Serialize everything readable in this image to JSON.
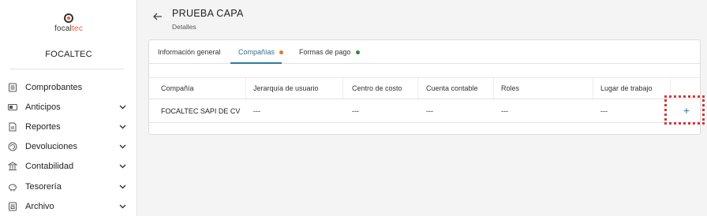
{
  "sidebar": {
    "logo": {
      "part1": "focal",
      "part2": "tec"
    },
    "company": "FOCALTEC",
    "items": [
      {
        "label": "Comprobantes",
        "icon": "document-list-icon",
        "expandable": false
      },
      {
        "label": "Anticipos",
        "icon": "cash-icon",
        "expandable": true
      },
      {
        "label": "Reportes",
        "icon": "report-icon",
        "expandable": true
      },
      {
        "label": "Devoluciones",
        "icon": "refund-icon",
        "expandable": true
      },
      {
        "label": "Contabilidad",
        "icon": "bank-icon",
        "expandable": true
      },
      {
        "label": "Tesorería",
        "icon": "piggy-bank-icon",
        "expandable": true
      },
      {
        "label": "Archivo",
        "icon": "archive-icon",
        "expandable": true
      }
    ]
  },
  "header": {
    "title": "PRUEBA CAPA",
    "subtitle": "Detalles"
  },
  "tabs": [
    {
      "label": "Información general",
      "dot": null,
      "active": false
    },
    {
      "label": "Compañías",
      "dot": "#e8742a",
      "active": true
    },
    {
      "label": "Formas de pago",
      "dot": "#2e8b3a",
      "active": false
    }
  ],
  "table": {
    "columns": [
      "Compañía",
      "Jerarquía de usuario",
      "Centro de costo",
      "Cuenta contable",
      "Roles",
      "Lugar de trabajo"
    ],
    "rows": [
      [
        "FOCALTEC SAPI DE CV",
        "---",
        "---",
        "---",
        "---",
        "---"
      ]
    ],
    "add_label": "+"
  },
  "colors": {
    "accent": "#2f7aa0",
    "highlight": "#dd3333"
  }
}
